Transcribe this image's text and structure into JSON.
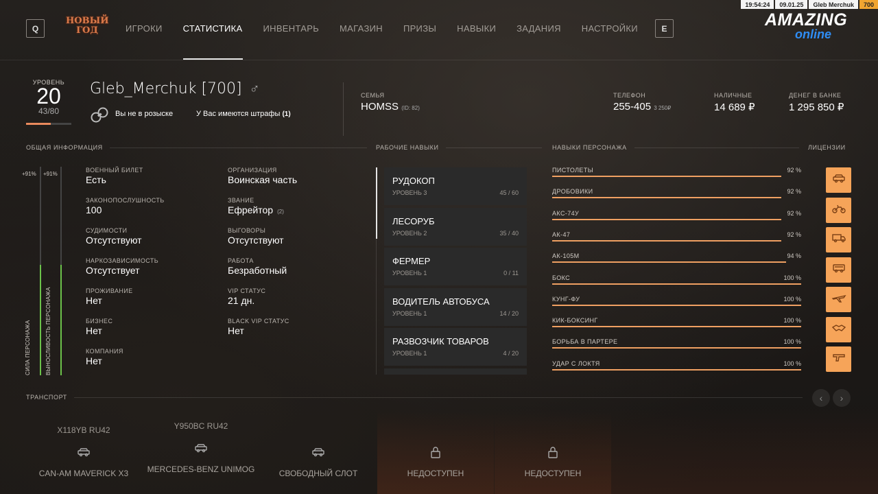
{
  "statusbar": {
    "time": "19:54:24",
    "date": "09.01.25",
    "nick": "Gleb Merchuk",
    "level": "700"
  },
  "nav": {
    "q_key": "Q",
    "e_key": "E",
    "event_logo": "НОВЫЙ ГОД",
    "items": [
      "ИГРОКИ",
      "СТАТИСТИКА",
      "ИНВЕНТАРЬ",
      "МАГАЗИН",
      "ПРИЗЫ",
      "НАВЫКИ",
      "ЗАДАНИЯ",
      "НАСТРОЙКИ"
    ],
    "active_index": 1
  },
  "brand": {
    "top": "AMAZING",
    "bottom": "online"
  },
  "profile": {
    "level_caption": "УРОВЕНЬ",
    "level": "20",
    "xp": "43/80",
    "xp_fraction": 0.54,
    "name": "Gleb_Merchuk [700]",
    "gender_icon": "♂",
    "wanted": "Вы не в розыске",
    "fines_text": "У Вас имеются штрафы",
    "fines_count": "(1)"
  },
  "stats": {
    "family_cap": "СЕМЬЯ",
    "family": "HOMSS",
    "family_id": "(ID: 82)",
    "phone_cap": "ТЕЛЕФОН",
    "phone": "255-405",
    "phone_bal": "3 250₽",
    "cash_cap": "НАЛИЧНЫЕ",
    "cash": "14 689 ₽",
    "bank_cap": "ДЕНЕГ В БАНКЕ",
    "bank": "1 295 850 ₽"
  },
  "sections": {
    "general": "ОБЩАЯ ИНФОРМАЦИЯ",
    "work": "РАБОЧИЕ НАВЫКИ",
    "char": "НАВЫКИ ПЕРСОНАЖА",
    "licenses": "ЛИЦЕНЗИИ",
    "transport": "ТРАНСПОРТ"
  },
  "general": {
    "strength_label": "СИЛА ПЕРСОНАЖА",
    "stamina_label": "ВЫНОСЛИВОСТЬ ПЕРСОНАЖА",
    "strength_pct": "+91%",
    "stamina_pct": "+91%",
    "strength_value": 0.53,
    "stamina_value": 0.53,
    "left": [
      {
        "k": "ВОЕННЫЙ БИЛЕТ",
        "v": "Есть"
      },
      {
        "k": "ЗАКОНОПОСЛУШНОСТЬ",
        "v": "100"
      },
      {
        "k": "СУДИМОСТИ",
        "v": "Отсутствуют"
      },
      {
        "k": "НАРКОЗАВИСИМОСТЬ",
        "v": "Отсутствует"
      },
      {
        "k": "ПРОЖИВАНИЕ",
        "v": "Нет"
      },
      {
        "k": "БИЗНЕС",
        "v": "Нет"
      },
      {
        "k": "КОМПАНИЯ",
        "v": "Нет"
      }
    ],
    "right": [
      {
        "k": "ОРГАНИЗАЦИЯ",
        "v": "Воинская часть"
      },
      {
        "k": "ЗВАНИЕ",
        "v": "Ефрейтор",
        "s": "(2)"
      },
      {
        "k": "ВЫГОВОРЫ",
        "v": "Отсутствуют"
      },
      {
        "k": "РАБОТА",
        "v": "Безработный"
      },
      {
        "k": "VIP СТАТУС",
        "v": "21 дн."
      },
      {
        "k": "BLACK VIP СТАТУС",
        "v": "Нет"
      }
    ]
  },
  "work_skills": [
    {
      "title": "РУДОКОП",
      "level": "УРОВЕНЬ 3",
      "progress": "45 / 60"
    },
    {
      "title": "ЛЕСОРУБ",
      "level": "УРОВЕНЬ 2",
      "progress": "35 / 40"
    },
    {
      "title": "ФЕРМЕР",
      "level": "УРОВЕНЬ 1",
      "progress": "0 / 11"
    },
    {
      "title": "ВОДИТЕЛЬ АВТОБУСА",
      "level": "УРОВЕНЬ 1",
      "progress": "14 / 20"
    },
    {
      "title": "РАЗВОЗЧИК ТОВАРОВ",
      "level": "УРОВЕНЬ 1",
      "progress": "4 / 20"
    }
  ],
  "char_skills": [
    {
      "name": "ПИСТОЛЕТЫ",
      "pct": "92 %",
      "value": 0.92
    },
    {
      "name": "ДРОБОВИКИ",
      "pct": "92 %",
      "value": 0.92
    },
    {
      "name": "АКС-74У",
      "pct": "92 %",
      "value": 0.92
    },
    {
      "name": "АК-47",
      "pct": "92 %",
      "value": 0.92
    },
    {
      "name": "АК-105М",
      "pct": "94 %",
      "value": 0.94
    },
    {
      "name": "БОКС",
      "pct": "100 %",
      "value": 1.0
    },
    {
      "name": "КУНГ-ФУ",
      "pct": "100 %",
      "value": 1.0
    },
    {
      "name": "КИК-БОКСИНГ",
      "pct": "100 %",
      "value": 1.0
    },
    {
      "name": "БОРЬБА В ПАРТЕРЕ",
      "pct": "100 %",
      "value": 1.0
    },
    {
      "name": "УДАР С ЛОКТЯ",
      "pct": "100 %",
      "value": 1.0
    }
  ],
  "licenses": [
    "car-icon",
    "motorcycle-icon",
    "truck-icon",
    "bus-icon",
    "plane-icon",
    "handshake-icon",
    "pistol-icon"
  ],
  "transport": [
    {
      "plate": "X118YB RU42",
      "name": "CAN-AM MAVERICK X3",
      "icon": "car-icon"
    },
    {
      "plate": "Y950BC RU42",
      "name": "MERCEDES-BENZ UNIMOG",
      "icon": "car-icon"
    },
    {
      "plate": "",
      "name": "СВОБОДНЫЙ СЛОТ",
      "icon": "car-icon"
    },
    {
      "plate": "",
      "name": "НЕДОСТУПЕН",
      "icon": "lock-icon"
    },
    {
      "plate": "",
      "name": "НЕДОСТУПЕН",
      "icon": "lock-icon"
    }
  ],
  "colors": {
    "accent": "#f6a459",
    "green": "#6cc24a",
    "brand_blue": "#2f8df5"
  }
}
